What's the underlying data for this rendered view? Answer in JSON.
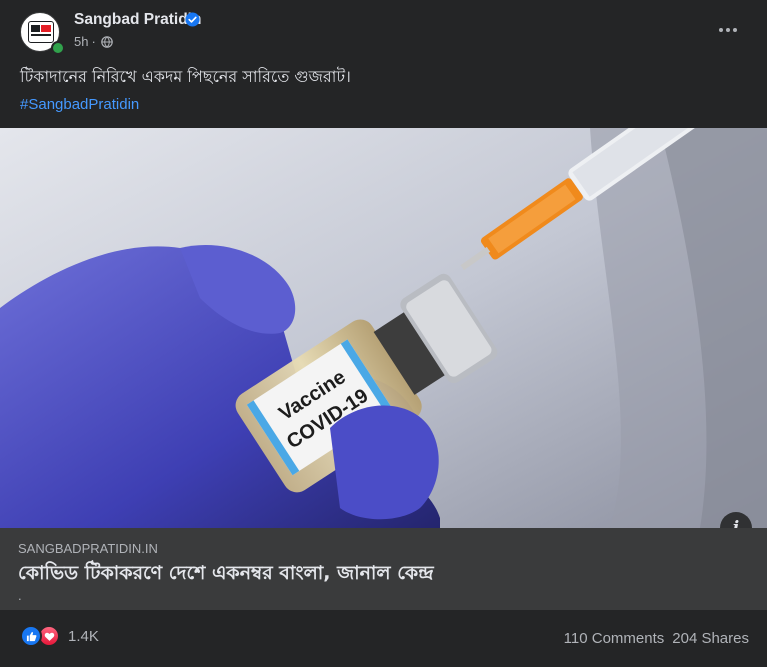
{
  "post": {
    "page_name": "Sangbad Pratidin",
    "time": "5h",
    "separator": "·",
    "text": "টিকাদানের নিরিখে একদম পিছনের সারিতে গুজরাট।",
    "hashtag": "#SangbadPratidin",
    "image_label_1": "Vaccine",
    "image_label_2": "COVID-19"
  },
  "link": {
    "domain": "SANGBADPRATIDIN.IN",
    "title": "কোভিড টিকাকরণে দেশে একনম্বর বাংলা, জানাল কেন্দ্র",
    "description": "."
  },
  "footer": {
    "reaction_count": "1.4K",
    "comments": "110 Comments",
    "shares": "204 Shares"
  },
  "icons": {
    "verified": "verified-badge-icon",
    "globe": "globe-icon",
    "more": "more-horizontal-icon",
    "info": "info-icon",
    "like": "like-reaction-icon",
    "love": "love-reaction-icon"
  },
  "colors": {
    "background": "#242526",
    "link_box": "#3a3b3c",
    "hashtag": "#4599ff",
    "verified": "#1877f2",
    "online": "#31a24c"
  }
}
